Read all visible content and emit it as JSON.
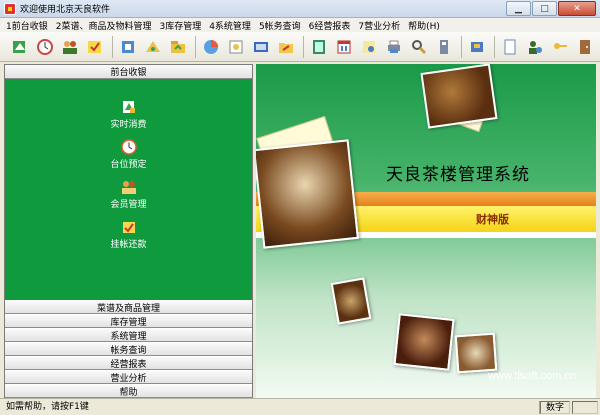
{
  "window": {
    "title": "欢迎使用北京天良软件"
  },
  "menu": [
    "1前台收银",
    "2菜谱、商品及物料管理",
    "3库存管理",
    "4系统管理",
    "5帐务查询",
    "6经营报表",
    "7营业分析",
    "帮助(H)"
  ],
  "toolbar": {
    "icons": [
      "realtime-consume-icon",
      "reserve-clock-icon",
      "members-icon",
      "checkout-icon",
      "menu-book-icon",
      "goods-icon",
      "materials-icon",
      "stock-icon",
      "inventory-icon",
      "report-book-icon",
      "folder-icon",
      "monitor-icon",
      "calendar-icon",
      "notes-icon",
      "print-icon",
      "query-icon",
      "disk-icon",
      "users-icon",
      "document-icon",
      "user-settings-icon",
      "key-icon",
      "exit-door-icon"
    ]
  },
  "left_panel": {
    "top_header": "前台收银",
    "nav_items": [
      {
        "label": "实时消费",
        "icon": "realtime-consume-icon"
      },
      {
        "label": "台位预定",
        "icon": "clock-icon"
      },
      {
        "label": "会员管理",
        "icon": "members-icon"
      },
      {
        "label": "挂帐还款",
        "icon": "pay-back-icon"
      }
    ],
    "bottom_headers": [
      "菜谱及商品管理",
      "库存管理",
      "系统管理",
      "帐务查询",
      "经营报表",
      "营业分析",
      "帮助"
    ]
  },
  "splash": {
    "title": "天良茶楼管理系统",
    "edition": "财神版",
    "url": "www.tlsoft.com.cn",
    "colors": {
      "green": "#109a3e",
      "orange": "#e67f1e",
      "yellow": "#f5d317"
    }
  },
  "status": {
    "help_text": "如需帮助，请按F1键",
    "num_lock": "数字"
  }
}
